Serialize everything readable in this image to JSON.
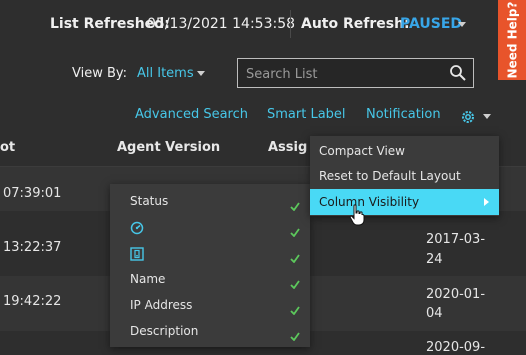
{
  "header": {
    "list_refreshed_label": "List Refreshed:",
    "list_refreshed_value": "05/13/2021 14:53:58",
    "auto_refresh_label": "Auto Refresh:",
    "auto_refresh_value": "PAUSED",
    "help_tab": "Need Help?"
  },
  "viewby": {
    "label": "View By:",
    "value": "All Items"
  },
  "search": {
    "placeholder": "Search List"
  },
  "links": {
    "advanced_search": "Advanced Search",
    "smart_label": "Smart Label",
    "notification": "Notification"
  },
  "table": {
    "columns": [
      "ot",
      "Agent Version",
      "Assig"
    ],
    "rows": [
      {
        "col1": "07:39:01",
        "col4a": "",
        "col4b": ""
      },
      {
        "col1": "13:22:37",
        "col4a": "2017-03-",
        "col4b": "24"
      },
      {
        "col1": "19:42:22",
        "col4a": "2020-01-",
        "col4b": "04"
      },
      {
        "col1": "",
        "col4a": "2020-09-",
        "col4b": ""
      }
    ]
  },
  "gear_menu": {
    "items": [
      "Compact View",
      "Reset to Default Layout",
      "Column Visibility"
    ]
  },
  "column_visibility": {
    "items": [
      {
        "label": "Status",
        "icon": ""
      },
      {
        "label": "",
        "icon": "gauge-icon"
      },
      {
        "label": "",
        "icon": "device-icon"
      },
      {
        "label": "Name",
        "icon": ""
      },
      {
        "label": "IP Address",
        "icon": ""
      },
      {
        "label": "Description",
        "icon": ""
      }
    ]
  },
  "colors": {
    "accent": "#47c7e8",
    "paused": "#38a6e8",
    "help": "#e8542b",
    "menu_active": "#49d9f5",
    "check": "#5cc85c"
  }
}
